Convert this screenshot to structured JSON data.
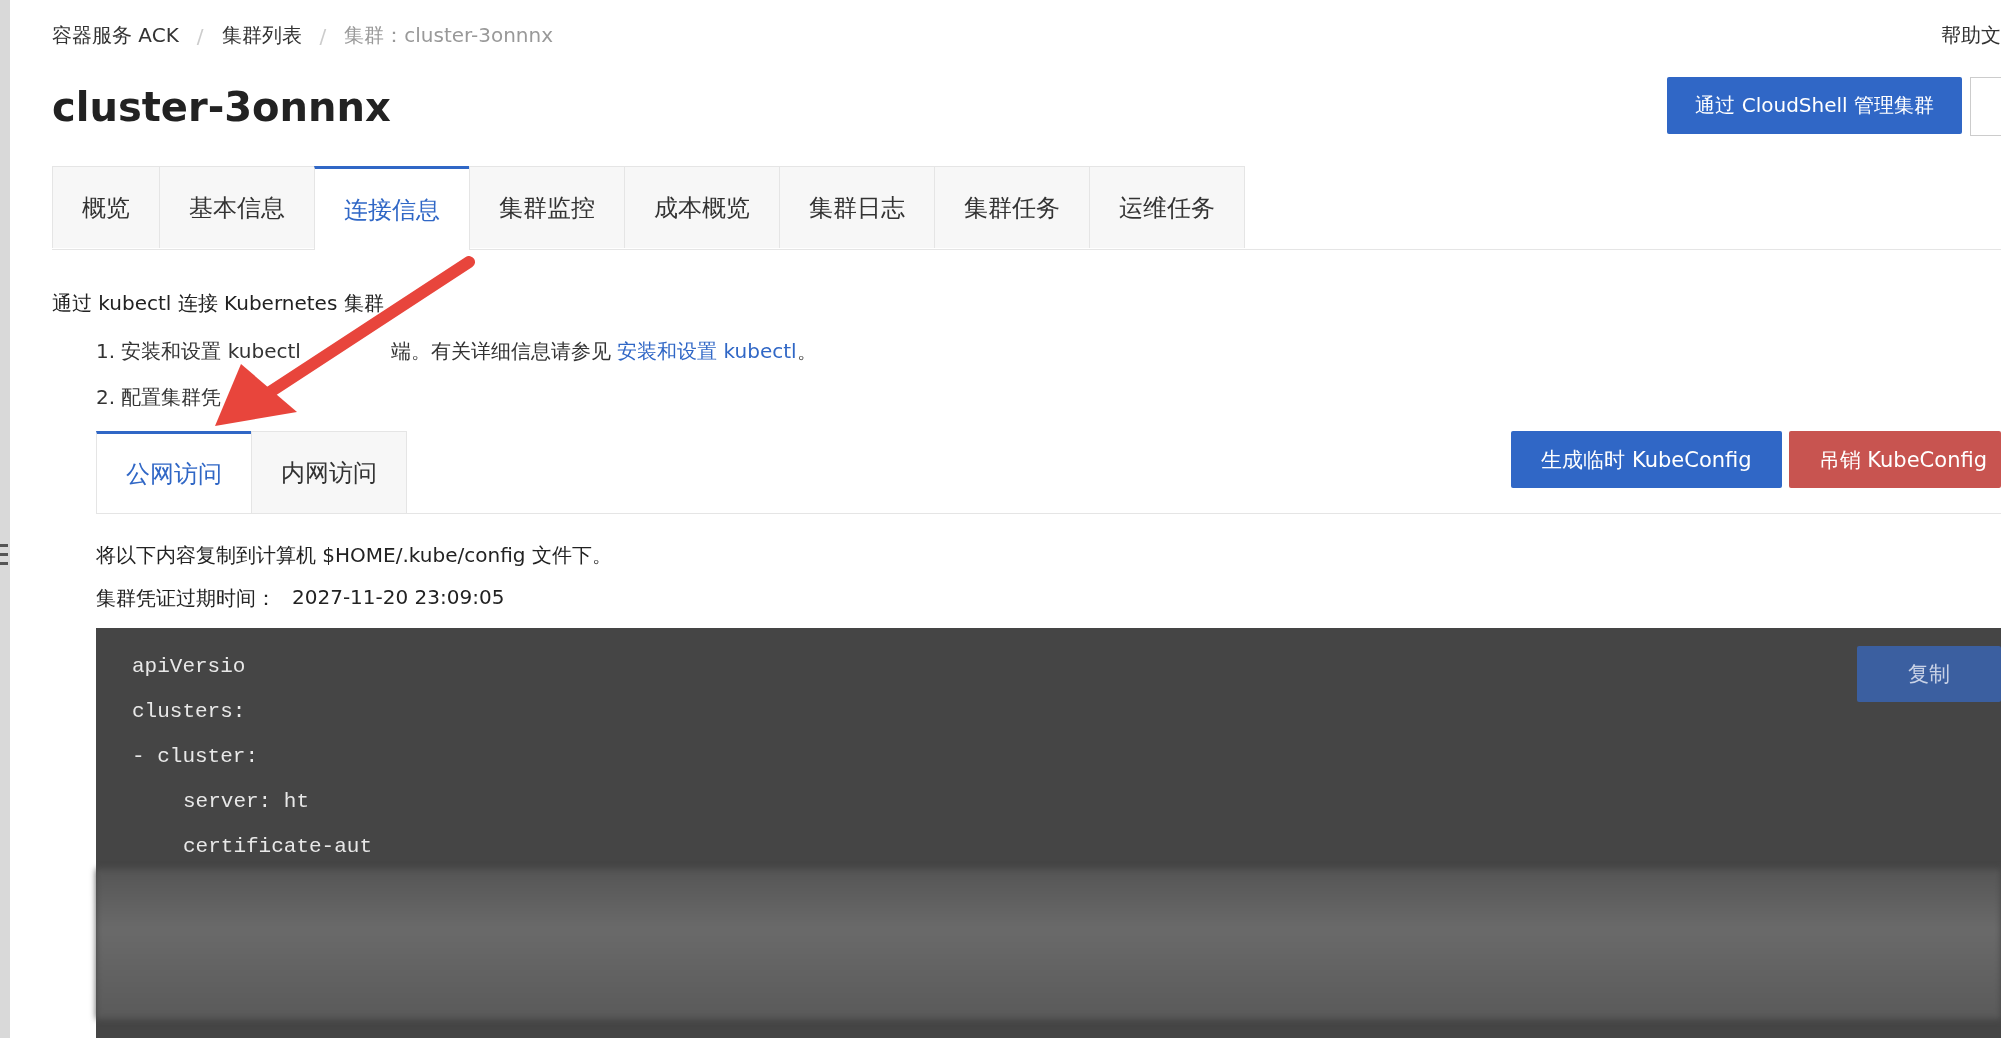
{
  "breadcrumb": [
    {
      "label": "容器服务 ACK"
    },
    {
      "separator": "/",
      "label": "集群列表"
    },
    {
      "separator": "/",
      "label": "集群：cluster-3onnnx"
    }
  ],
  "help_link": "帮助文",
  "title": "cluster-3onnnx",
  "header_button": "通过 CloudShell 管理集群",
  "tabs": [
    {
      "label": "概览",
      "selected": false
    },
    {
      "label": "基本信息",
      "selected": false
    },
    {
      "label": "连接信息",
      "selected": true
    },
    {
      "label": "集群监控",
      "selected": false
    },
    {
      "label": "成本概览",
      "selected": false
    },
    {
      "label": "集群日志",
      "selected": false
    },
    {
      "label": "集群任务",
      "selected": false
    },
    {
      "label": "运维任务",
      "selected": false
    }
  ],
  "intro": "通过 kubectl 连接 Kubernetes 集群",
  "steps": [
    {
      "text": "1. 安装和设置 kubectl",
      "after": "端。有关详细信息请参见",
      "link": "安装和设置 kubectl",
      "tail": "。"
    },
    {
      "text": "2. 配置集群凭"
    }
  ],
  "access_tabs": [
    {
      "label": "公网访问",
      "selected": true
    },
    {
      "label": "内网访问",
      "selected": false
    }
  ],
  "actions": [
    {
      "label": "生成临时 KubeConfig",
      "kind": "primary"
    },
    {
      "label": "吊销 KubeConfig",
      "kind": "danger"
    }
  ],
  "copy_hint": "将以下内容复制到计算机 $HOME/.kube/config 文件下。",
  "expiry_label": "集群凭证过期时间：",
  "expiry_value": "2027-11-20 23:09:05",
  "code": {
    "copy_button": "复制",
    "lines": [
      {
        "text": "apiVersio",
        "indent": false
      },
      {
        "text": "clusters:",
        "indent": false
      },
      {
        "text": "- cluster:",
        "indent": false
      },
      {
        "text": "server: ht",
        "indent": true
      },
      {
        "text": "certificate-aut",
        "indent": true
      }
    ]
  }
}
